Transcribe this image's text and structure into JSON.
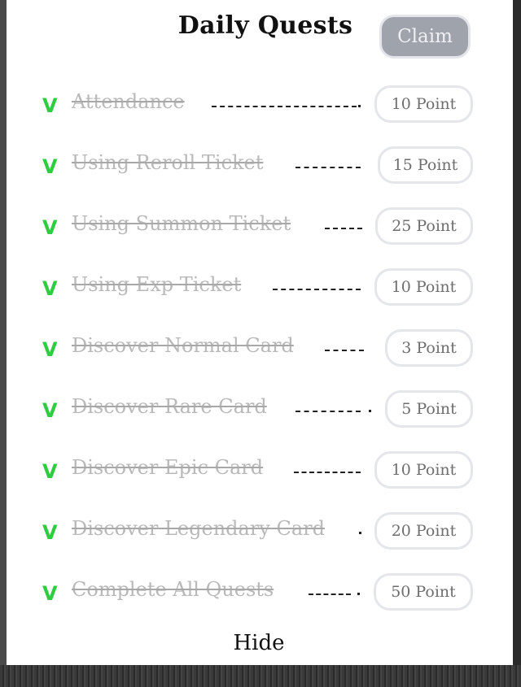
{
  "header": {
    "title": "Daily Quests",
    "claim_label": "Claim"
  },
  "check_glyph": "V",
  "quests": [
    {
      "label": "Attendance",
      "points": "10 Point"
    },
    {
      "label": "Using Reroll Ticket",
      "points": "15 Point"
    },
    {
      "label": "Using Summon Ticket",
      "points": "25 Point"
    },
    {
      "label": "Using Exp Ticket",
      "points": "10 Point"
    },
    {
      "label": "Discover Normal Card",
      "points": "3 Point"
    },
    {
      "label": "Discover Rare Card",
      "points": "5 Point"
    },
    {
      "label": "Discover Epic Card",
      "points": "10 Point"
    },
    {
      "label": "Discover Legendary Card",
      "points": "20 Point"
    },
    {
      "label": "Complete All Quests",
      "points": "50 Point"
    }
  ],
  "footer": {
    "hide_label": "Hide"
  },
  "colors": {
    "check": "#2ecc40",
    "completed_text": "#b9b9b9",
    "claim_disabled": "#9fa3ab"
  }
}
